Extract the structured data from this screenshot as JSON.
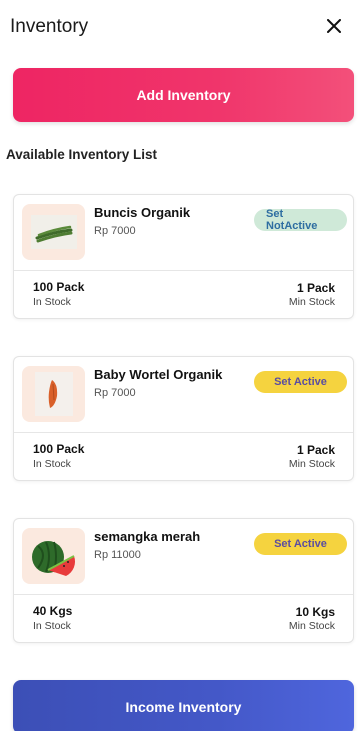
{
  "header": {
    "title": "Inventory",
    "close_icon": "close-icon"
  },
  "actions": {
    "add_label": "Add Inventory",
    "income_label": "Income Inventory"
  },
  "list": {
    "title": "Available Inventory List",
    "items": [
      {
        "name": "Buncis Organik",
        "price": "Rp 7000",
        "badge": "Set NotActive",
        "stock": "100 Pack",
        "stock_label": "In Stock",
        "min": "1 Pack",
        "min_label": "Min Stock",
        "image": "green-beans"
      },
      {
        "name": "Baby Wortel Organik",
        "price": "Rp 7000",
        "badge": "Set Active",
        "stock": "100 Pack",
        "stock_label": "In Stock",
        "min": "1 Pack",
        "min_label": "Min Stock",
        "image": "baby-carrot"
      },
      {
        "name": "semangka merah",
        "price": "Rp 11000",
        "badge": "Set Active",
        "stock": "40 Kgs",
        "stock_label": "In Stock",
        "min": "10 Kgs",
        "min_label": "Min Stock",
        "image": "watermelon"
      }
    ]
  },
  "colors": {
    "add_button": "#ee2563",
    "income_button": "#4458c8",
    "notactive_badge": "#cfe9d8",
    "active_badge": "#f5d33f"
  }
}
